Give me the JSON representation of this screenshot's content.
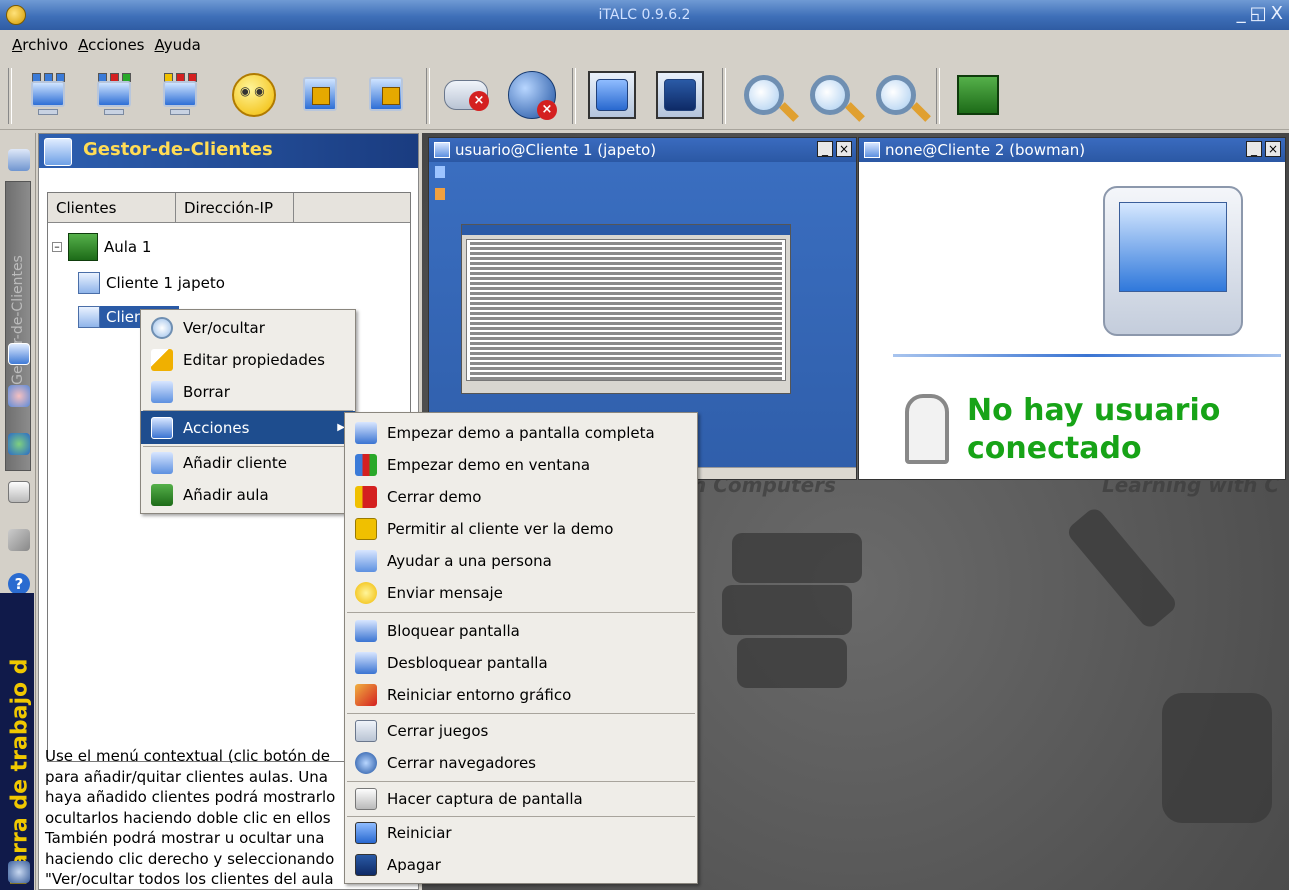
{
  "window": {
    "title": "iTALC 0.9.6.2",
    "controls": [
      "_",
      "◱",
      "X"
    ]
  },
  "menubar": {
    "items": [
      {
        "label": "Archivo",
        "key": "A",
        "rest": "rchivo"
      },
      {
        "label": "Acciones",
        "key": "A",
        "rest": "cciones"
      },
      {
        "label": "Ayuda",
        "key": "A",
        "rest": "yuda"
      }
    ]
  },
  "toolbar": {
    "buttons": [
      "fullscreen-demo-icon",
      "window-demo-icon",
      "stop-demo-icon",
      "send-message-icon",
      "lock-screen-icon",
      "unlock-screen-icon",
      "kill-games-icon",
      "kill-browsers-icon",
      "reboot-icon",
      "power-off-icon",
      "overview-icon",
      "zoom-in-icon",
      "zoom-out-icon",
      "classroom-icon"
    ]
  },
  "sidebar": {
    "vertical_tab": "Gestor-de-Clientes",
    "bar_label": "Barra de trabajo d"
  },
  "gestor": {
    "title": "Gestor-de-Clientes",
    "columns": [
      "Clientes",
      "Dirección-IP"
    ],
    "classroom": "Aula 1",
    "clients": [
      "Cliente 1 japeto",
      "Cliente 2"
    ],
    "description": [
      "Use el menú contextual (clic botón de",
      "para añadir/quitar clientes aulas. Una",
      "haya añadido clientes podrá mostrarlo",
      "ocultarlos haciendo doble clic en ellos",
      "También podrá mostrar u ocultar una",
      "haciendo clic derecho y seleccionando",
      "\"Ver/ocultar todos los clientes del aula"
    ]
  },
  "windows": {
    "client1_title": "usuario@Cliente 1 (japeto)",
    "client2_title": "none@Cliente 2 (bowman)",
    "no_user_line1": "No hay usuario",
    "no_user_line2": "conectado",
    "bg_text_left": "n Computers",
    "bg_text_right": "Learning with C"
  },
  "context_menu": {
    "items": [
      {
        "label": "Ver/ocultar",
        "icon": "magnifier-icon"
      },
      {
        "label": "Editar propiedades",
        "icon": "edit-pencil-icon"
      },
      {
        "label": "Borrar",
        "icon": "delete-icon"
      },
      {
        "label": "Acciones",
        "icon": "monitor-icon",
        "submenu": true
      },
      {
        "label": "Añadir cliente",
        "icon": "add-client-icon"
      },
      {
        "label": "Añadir aula",
        "icon": "add-classroom-icon"
      }
    ]
  },
  "submenu": {
    "items": [
      {
        "label": "Empezar demo a pantalla completa",
        "icon": "fullscreen-demo-icon"
      },
      {
        "label": "Empezar demo en ventana",
        "icon": "window-demo-icon"
      },
      {
        "label": "Cerrar demo",
        "icon": "stop-demo-icon"
      },
      {
        "label": "Permitir al cliente ver la demo",
        "icon": "allow-demo-icon"
      },
      {
        "label": "Ayudar a una persona",
        "icon": "help-person-icon"
      },
      {
        "label": "Enviar mensaje",
        "icon": "message-icon"
      },
      {
        "label": "Bloquear pantalla",
        "icon": "lock-icon"
      },
      {
        "label": "Desbloquear pantalla",
        "icon": "unlock-icon"
      },
      {
        "label": "Reiniciar entorno gráfico",
        "icon": "restart-x-icon"
      },
      {
        "label": "Cerrar juegos",
        "icon": "gamepad-icon"
      },
      {
        "label": "Cerrar navegadores",
        "icon": "globe-icon"
      },
      {
        "label": "Hacer captura de pantalla",
        "icon": "camera-icon"
      },
      {
        "label": "Reiniciar",
        "icon": "reboot-icon"
      },
      {
        "label": "Apagar",
        "icon": "power-off-icon"
      }
    ]
  },
  "colors": {
    "titlebar": "#3e6fb8",
    "selection": "#1e4d8e",
    "gestor_title": "#ffdc55",
    "no_user_text": "#17a317",
    "workbar": "#101a4a"
  }
}
